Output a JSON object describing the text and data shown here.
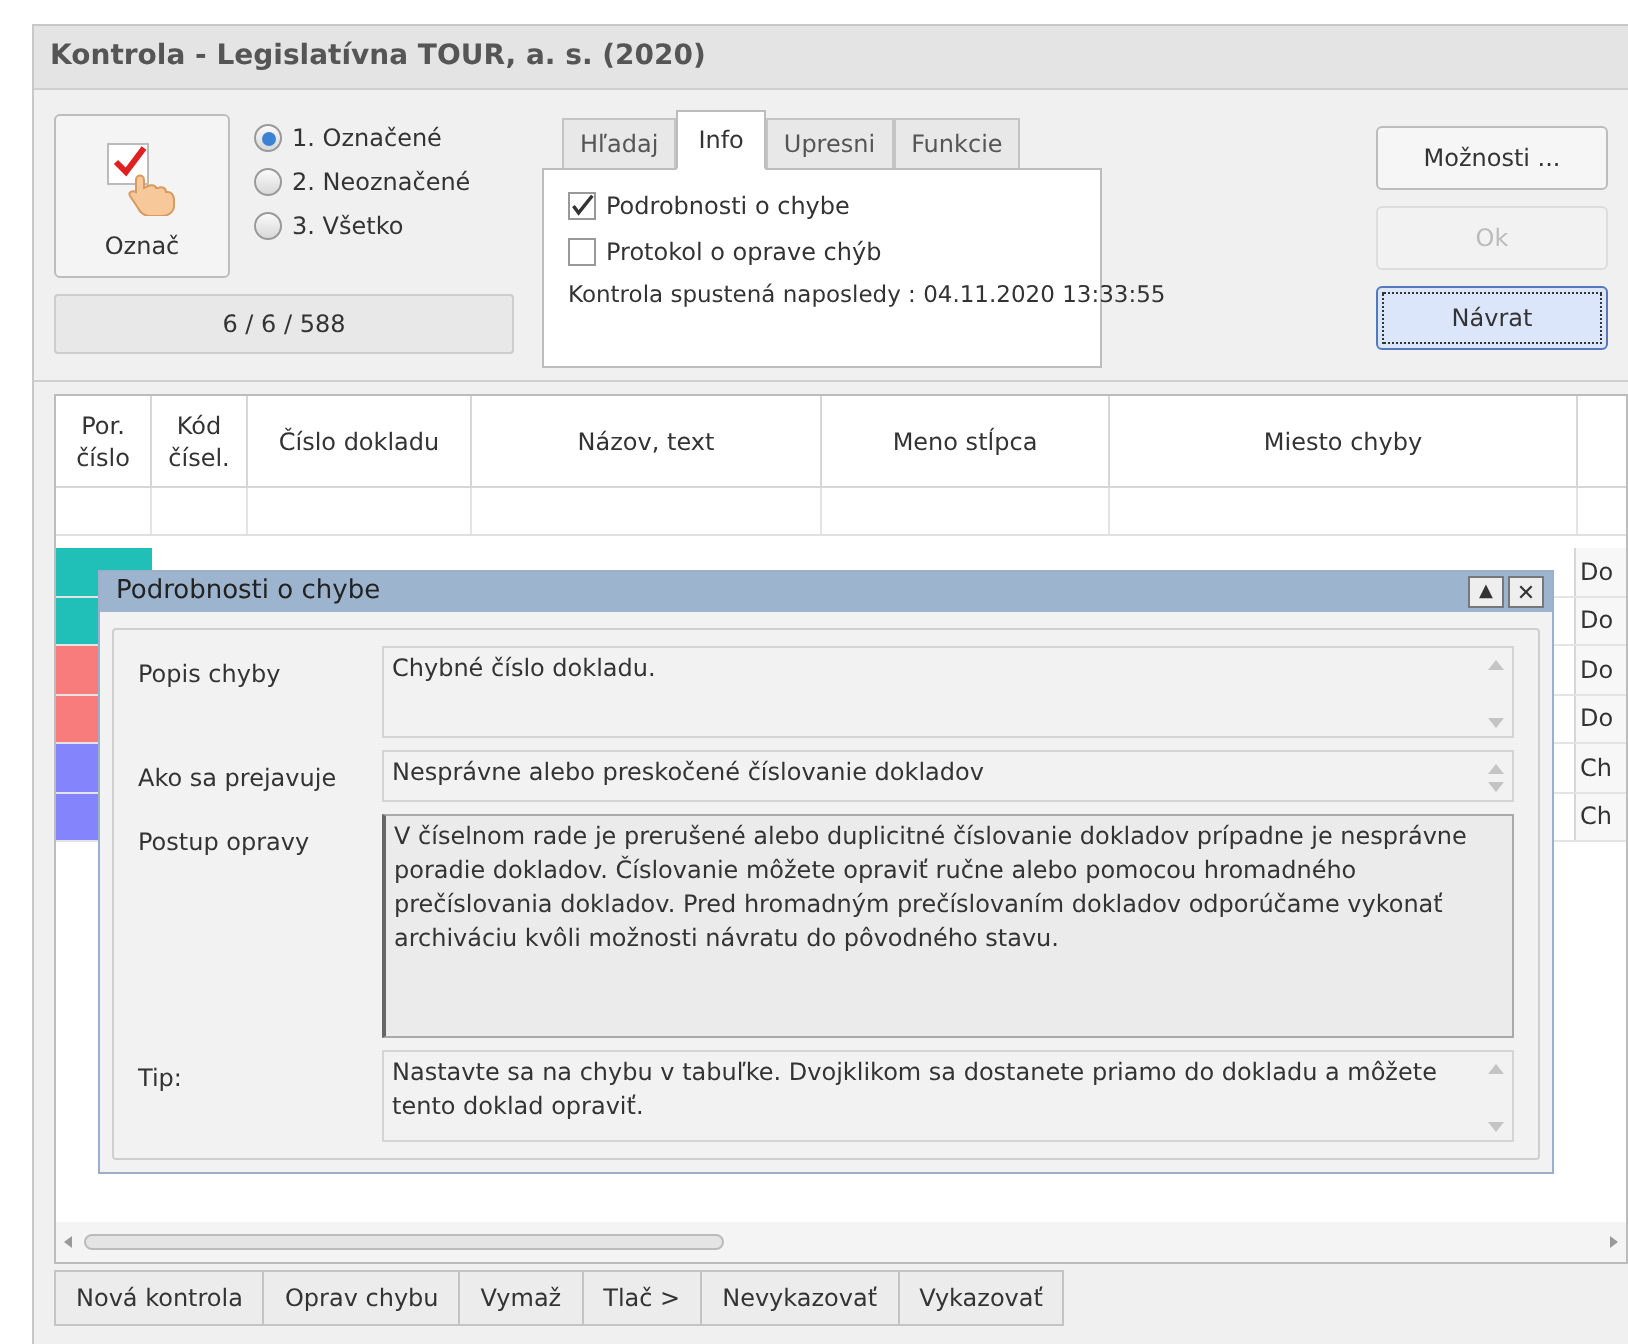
{
  "window": {
    "title": "Kontrola - Legislatívna TOUR, a. s. (2020)"
  },
  "mark_button": {
    "label": "Označ"
  },
  "filter_options": [
    {
      "label": "1. Označené",
      "selected": true
    },
    {
      "label": "2. Neoznačené",
      "selected": false
    },
    {
      "label": "3. Všetko",
      "selected": false
    }
  ],
  "counter": "6 / 6 / 588",
  "tabs": [
    {
      "label": "Hľadaj",
      "selected": false
    },
    {
      "label": "Info",
      "selected": true
    },
    {
      "label": "Upresni",
      "selected": false
    },
    {
      "label": "Funkcie",
      "selected": false
    }
  ],
  "info": {
    "options": [
      {
        "label": "Podrobnosti o chybe",
        "checked": true
      },
      {
        "label": "Protokol o oprave chýb",
        "checked": false
      }
    ],
    "last_run": "Kontrola spustená naposledy : 04.11.2020 13:33:55"
  },
  "side_buttons": [
    {
      "label": "Možnosti ...",
      "disabled": false,
      "focused": false
    },
    {
      "label": "Ok",
      "disabled": true,
      "focused": false
    },
    {
      "label": "Návrat",
      "disabled": false,
      "focused": true
    }
  ],
  "table": {
    "columns": [
      "Por. číslo",
      "Kód čísel.",
      "Číslo dokladu",
      "Názov, text",
      "Meno stĺpca",
      "Miesto chyby"
    ],
    "rows": [
      {
        "color": "#20c0b8",
        "column_7": "Do"
      },
      {
        "color": "#20c0b8",
        "column_7": "Do"
      },
      {
        "color": "#f87c7c",
        "column_7": "Do"
      },
      {
        "color": "#f87c7c",
        "column_7": "Do"
      },
      {
        "color": "#8484fc",
        "column_7": "Ch"
      },
      {
        "color": "#8484fc",
        "column_7": "Ch"
      }
    ]
  },
  "details": {
    "title": "Podrobnosti o chybe",
    "collapse": "▲",
    "close": "✕",
    "fields": [
      {
        "label": "Popis chyby",
        "value": "Chybné číslo dokladu.",
        "kind": "short"
      },
      {
        "label": "Ako sa prejavuje",
        "value": "Nesprávne alebo preskočené číslovanie dokladov",
        "kind": "line"
      },
      {
        "label": "Postup opravy",
        "value": "V číselnom rade je prerušené alebo duplicitné číslovanie dokladov prípadne je nesprávne poradie dokladov. Číslovanie môžete opraviť ručne alebo pomocou hromadného prečíslovania dokladov. Pred hromadným prečíslovaním dokladov odporúčame vykonať archiváciu kvôli možnosti návratu do pôvodného stavu.",
        "kind": "tall"
      },
      {
        "label": "Tip:",
        "value": "Nastavte sa na chybu v tabuľke. Dvojklikom sa dostanete priamo do dokladu a môžete tento doklad opraviť.",
        "kind": "short"
      }
    ]
  },
  "bottom_buttons": [
    "Nová kontrola",
    "Oprav chybu",
    "Vymaž",
    "Tlač >",
    "Nevykazovať",
    "Vykazovať"
  ]
}
